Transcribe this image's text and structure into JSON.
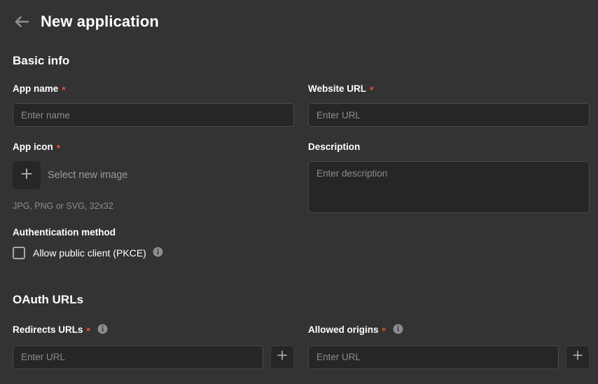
{
  "header": {
    "back_icon": "arrow-left-icon",
    "title": "New application"
  },
  "sections": {
    "basic_info": {
      "title": "Basic info",
      "app_name": {
        "label": "App name",
        "required_marker": "*",
        "placeholder": "Enter name",
        "value": ""
      },
      "website_url": {
        "label": "Website URL",
        "required_marker": "*",
        "placeholder": "Enter URL",
        "value": ""
      },
      "app_icon": {
        "label": "App icon",
        "required_marker": "*",
        "add_icon": "plus-icon",
        "select_label": "Select new image",
        "hint": "JPG, PNG or SVG, 32x32"
      },
      "description": {
        "label": "Description",
        "placeholder": "Enter description",
        "value": ""
      },
      "auth_method": {
        "label": "Authentication method",
        "checkbox_label": "Allow public client (PKCE)",
        "checked": false,
        "info_icon": "info-icon"
      }
    },
    "oauth_urls": {
      "title": "OAuth URLs",
      "redirects_urls": {
        "label": "Redirects URLs",
        "required_marker": "*",
        "info_icon": "info-icon",
        "placeholder": "Enter URL",
        "value": "",
        "add_icon": "plus-icon"
      },
      "allowed_origins": {
        "label": "Allowed origins",
        "required_marker": "*",
        "info_icon": "info-icon",
        "placeholder": "Enter URL",
        "value": "",
        "add_icon": "plus-icon"
      }
    }
  },
  "colors": {
    "page_background": "#333333",
    "input_background": "#262626",
    "input_border": "#4a4a4a",
    "required_asterisk": "#e8502f",
    "text_primary": "#ffffff",
    "text_muted": "#8c8c8c"
  }
}
